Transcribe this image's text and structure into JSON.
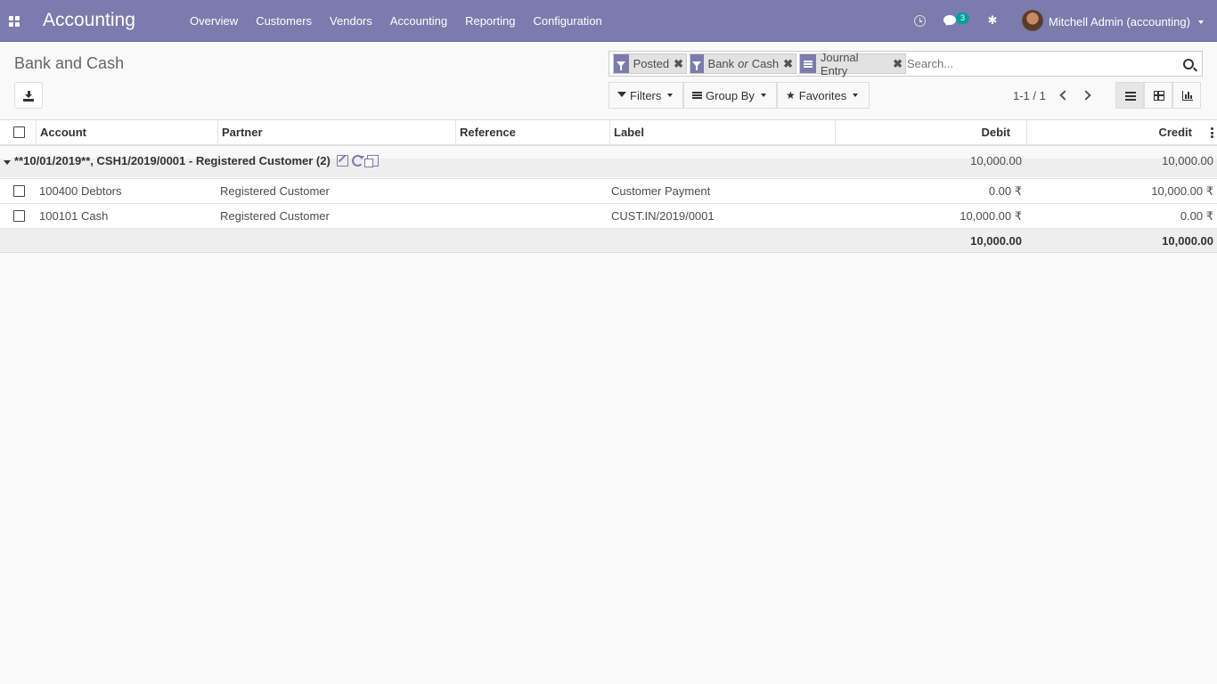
{
  "navbar": {
    "brand": "Accounting",
    "menu": [
      "Overview",
      "Customers",
      "Vendors",
      "Accounting",
      "Reporting",
      "Configuration"
    ],
    "messages_count": "3",
    "user": "Mitchell Admin (accounting)",
    "accent_color": "#7c7bad"
  },
  "control_panel": {
    "breadcrumb": "Bank and Cash",
    "facets": [
      {
        "type": "filter",
        "label": "Posted"
      },
      {
        "type": "filter",
        "label_a": "Bank",
        "label_or": "or",
        "label_b": "Cash"
      },
      {
        "type": "groupby",
        "label": "Journal Entry"
      }
    ],
    "search_placeholder": "Search...",
    "filters_label": "Filters",
    "groupby_label": "Group By",
    "favorites_label": "Favorites",
    "pager": "1-1 / 1"
  },
  "table": {
    "columns": {
      "account": "Account",
      "partner": "Partner",
      "reference": "Reference",
      "label": "Label",
      "debit": "Debit",
      "credit": "Credit"
    },
    "group": {
      "title": "**10/01/2019**, CSH1/2019/0001 - Registered Customer (2)",
      "debit": "10,000.00",
      "credit": "10,000.00"
    },
    "rows": [
      {
        "account": "100400 Debtors",
        "partner": "Registered Customer",
        "reference": "",
        "label": "Customer Payment",
        "debit": "0.00 ₹",
        "credit": "10,000.00 ₹"
      },
      {
        "account": "100101 Cash",
        "partner": "Registered Customer",
        "reference": "",
        "label": "CUST.IN/2019/0001",
        "debit": "10,000.00 ₹",
        "credit": "0.00 ₹"
      }
    ],
    "totals": {
      "debit": "10,000.00",
      "credit": "10,000.00"
    }
  }
}
